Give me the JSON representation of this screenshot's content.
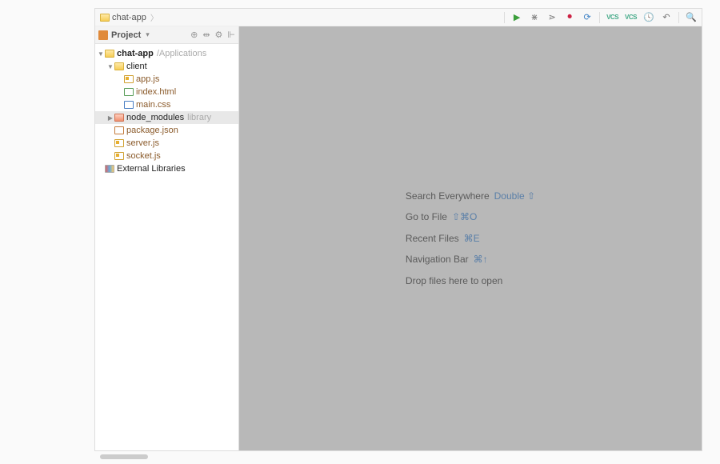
{
  "breadcrumb": {
    "project": "chat-app"
  },
  "toolbar": {
    "vcs": "VCS"
  },
  "sidebar": {
    "title": "Project",
    "tools": {
      "target": "⊕",
      "collapse": "⇹",
      "gear": "⚙",
      "hide": "⊩"
    }
  },
  "tree": {
    "root": {
      "name": "chat-app",
      "hint": "/Applications"
    },
    "client": "client",
    "appjs": "app.js",
    "indexhtml": "index.html",
    "maincss": "main.css",
    "nodemod": "node_modules",
    "nodemod_hint": "library",
    "pkg": "package.json",
    "serverjs": "server.js",
    "socketjs": "socket.js",
    "extlib": "External Libraries"
  },
  "tips": {
    "search": "Search Everywhere",
    "search_key": "Double ⇧",
    "gotofile": "Go to File",
    "gotofile_key": "⇧⌘O",
    "recent": "Recent Files",
    "recent_key": "⌘E",
    "navbar": "Navigation Bar",
    "navbar_key": "⌘↑",
    "drop": "Drop files here to open"
  }
}
